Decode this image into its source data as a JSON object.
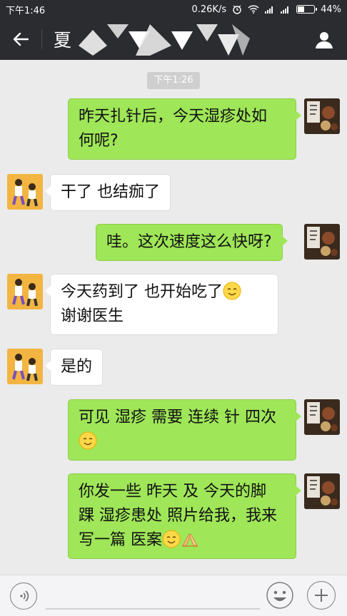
{
  "status_bar": {
    "time": "下午1:46",
    "network_speed": "0.26K/s",
    "battery": "44%",
    "battery_level": 0.44
  },
  "header": {
    "title": "夏"
  },
  "chat": {
    "timestamp": "下午1:26",
    "messages": [
      {
        "from": "me",
        "lines": [
          "昨天扎针后，今天湿疹处如",
          "何呢?"
        ]
      },
      {
        "from": "them",
        "lines": [
          "干了 也结痂了"
        ]
      },
      {
        "from": "me",
        "lines": [
          "哇。这次速度这么快呀?"
        ]
      },
      {
        "from": "them",
        "lines": [
          "今天药到了 也开始吃了",
          "谢谢医生"
        ]
      },
      {
        "from": "them",
        "lines": [
          "是的"
        ]
      },
      {
        "from": "me",
        "lines": [
          "可见 湿疹 需要 连续 针 四次"
        ]
      },
      {
        "from": "me",
        "lines": [
          "你发一些 昨天 及 今天的脚",
          "踝 湿疹患处 照片给我，我来",
          "写一篇 医案"
        ]
      }
    ]
  },
  "colors": {
    "header_bg": "#2b2c2f",
    "chat_bg": "#ebebeb",
    "bubble_me": "#9fe658",
    "bubble_them": "#ffffff"
  },
  "icons": {
    "back": "back-arrow-icon",
    "profile": "person-icon",
    "voice": "voice-icon",
    "emoji": "smiley-icon",
    "plus": "plus-icon"
  }
}
